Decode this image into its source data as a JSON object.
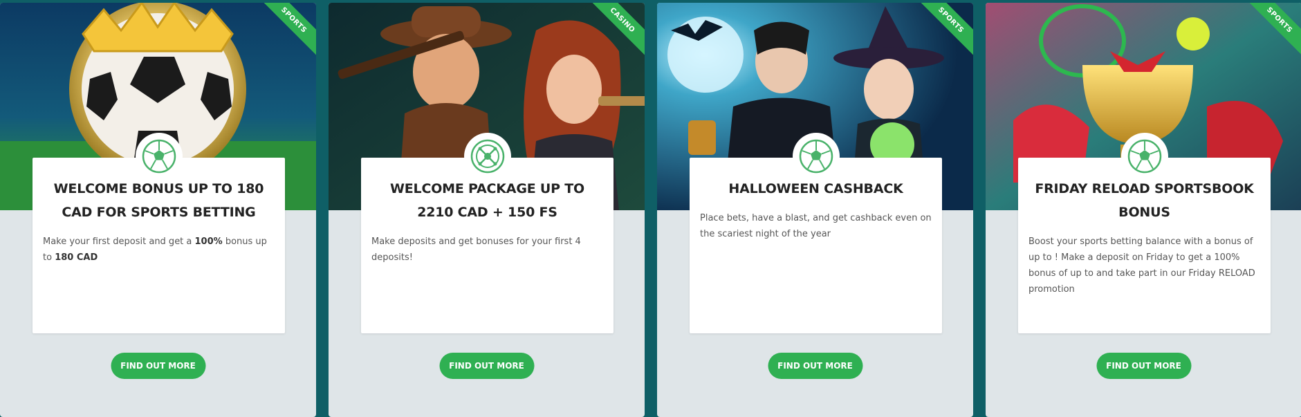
{
  "cards": [
    {
      "ribbon": "SPORTS",
      "icon": "soccer-ball-icon",
      "title": "WELCOME BONUS UP TO 180 CAD FOR SPORTS BETTING",
      "desc_pre": "Make your first deposit and get a ",
      "desc_bold1": "100%",
      "desc_mid": " bonus up to ",
      "desc_bold2": "180 CAD",
      "button": "FIND OUT MORE"
    },
    {
      "ribbon": "CASINO",
      "icon": "roulette-wheel-icon",
      "title": "WELCOME PACKAGE UP TO 2210 CAD + 150 FS",
      "desc": "Make deposits and get bonuses for your first 4 deposits!",
      "button": "FIND OUT MORE"
    },
    {
      "ribbon": "SPORTS",
      "icon": "soccer-ball-icon",
      "title": "HALLOWEEN CASHBACK",
      "desc": "Place bets, have a blast, and get cashback even on the scariest night of the year",
      "button": "FIND OUT MORE"
    },
    {
      "ribbon": "SPORTS",
      "icon": "soccer-ball-icon",
      "title": "FRIDAY RELOAD SPORTSBOOK BONUS",
      "desc": "Boost your sports betting balance with a bonus of up to ! Make a deposit on Friday to get a 100% bonus of up to and take part in our Friday RELOAD promotion",
      "button": "FIND OUT MORE"
    }
  ],
  "colors": {
    "accent": "#2fb052",
    "page_bg": "#0f5f66",
    "card_bg": "#dfe5e8"
  }
}
